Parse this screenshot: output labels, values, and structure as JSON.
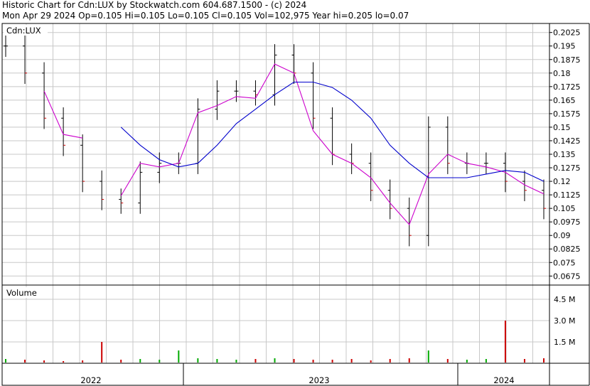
{
  "header": {
    "line1": "Historic Chart for Cdn:LUX by Stockwatch.com 604.687.1500 - (c) 2024",
    "line2": "Mon Apr 29 2024  Op=0.105  Hi=0.105  Lo=0.105  Cl=0.105  Vol=102,975  Year hi=0.205  lo=0.07"
  },
  "colors": {
    "price_bars": "#000000",
    "down_tick": "#cc0000",
    "ma_short": "#cc00cc",
    "ma_long": "#0000cc",
    "vol_up": "#00aa00",
    "vol_down": "#cc0000",
    "grid": "#c8c8c8"
  },
  "chart_data": [
    {
      "type": "line",
      "panel": "price",
      "title": "Cdn:LUX",
      "ylim": [
        0.0625,
        0.2075
      ],
      "y_ticks": [
        "0.2025",
        "0.195",
        "0.1875",
        "0.18",
        "0.1725",
        "0.165",
        "0.1575",
        "0.15",
        "0.1425",
        "0.135",
        "0.1275",
        "0.12",
        "0.1125",
        "0.105",
        "0.0975",
        "0.09",
        "0.0825",
        "0.075",
        "0.0675"
      ],
      "x_labels": [
        "2022",
        "2023",
        "2024"
      ],
      "grid": true,
      "series": [
        {
          "style": "ohlc",
          "x": [
            "2021-12",
            "2022-01",
            "2022-02",
            "2022-03",
            "2022-04",
            "2022-05",
            "2022-06",
            "2022-07",
            "2022-08",
            "2022-09",
            "2022-10",
            "2022-11",
            "2022-12",
            "2023-01",
            "2023-02",
            "2023-03",
            "2023-04",
            "2023-05",
            "2023-06",
            "2023-07",
            "2023-08",
            "2023-09",
            "2023-10",
            "2023-11",
            "2023-12",
            "2024-01",
            "2024-02",
            "2024-03",
            "2024-04"
          ],
          "values": [
            0.195,
            0.18,
            0.155,
            0.14,
            0.12,
            0.11,
            0.108,
            0.125,
            0.13,
            0.13,
            0.16,
            0.17,
            0.17,
            0.168,
            0.19,
            0.18,
            0.155,
            0.135,
            0.13,
            0.115,
            0.105,
            0.09,
            0.15,
            0.13,
            0.13,
            0.13,
            0.12,
            0.115,
            0.105
          ]
        },
        {
          "style": "moving-average",
          "x": [
            "2021-12",
            "2022-01",
            "2022-02",
            "2022-03",
            "2022-04",
            "2022-05",
            "2022-06",
            "2022-07",
            "2022-08",
            "2022-09",
            "2022-10",
            "2022-11",
            "2022-12",
            "2023-01",
            "2023-02",
            "2023-03",
            "2023-04",
            "2023-05",
            "2023-06",
            "2023-07",
            "2023-08",
            "2023-09",
            "2023-10",
            "2023-11",
            "2023-12",
            "2024-01",
            "2024-02",
            "2024-03",
            "2024-04"
          ],
          "values": [
            null,
            null,
            0.17,
            0.146,
            0.144,
            null,
            0.112,
            0.13,
            0.128,
            0.13,
            0.158,
            0.162,
            0.167,
            0.166,
            0.185,
            0.18,
            0.148,
            0.135,
            0.13,
            0.122,
            0.108,
            0.096,
            0.124,
            0.135,
            0.13,
            0.128,
            0.125,
            0.118,
            0.113
          ]
        },
        {
          "style": "moving-average",
          "x": [
            "2021-12",
            "2022-01",
            "2022-02",
            "2022-03",
            "2022-04",
            "2022-05",
            "2022-06",
            "2022-07",
            "2022-08",
            "2022-09",
            "2022-10",
            "2022-11",
            "2022-12",
            "2023-01",
            "2023-02",
            "2023-03",
            "2023-04",
            "2023-05",
            "2023-06",
            "2023-07",
            "2023-08",
            "2023-09",
            "2023-10",
            "2023-11",
            "2023-12",
            "2024-01",
            "2024-02",
            "2024-03",
            "2024-04"
          ],
          "values": [
            null,
            null,
            null,
            null,
            null,
            null,
            0.15,
            0.14,
            0.132,
            0.128,
            0.13,
            0.14,
            0.152,
            0.16,
            0.168,
            0.175,
            0.175,
            0.172,
            0.165,
            0.155,
            0.14,
            0.13,
            0.122,
            0.122,
            0.122,
            0.124,
            0.126,
            0.125,
            0.12
          ]
        }
      ]
    },
    {
      "type": "bar",
      "panel": "volume",
      "title": "Volume",
      "ylim": [
        0,
        5500000
      ],
      "y_ticks": [
        "4.5 M",
        "3.0 M",
        "1.5 M"
      ],
      "x": [
        "2021-12",
        "2022-01",
        "2022-02",
        "2022-03",
        "2022-04",
        "2022-05",
        "2022-06",
        "2022-07",
        "2022-08",
        "2022-09",
        "2022-10",
        "2022-11",
        "2022-12",
        "2023-01",
        "2023-02",
        "2023-03",
        "2023-04",
        "2023-05",
        "2023-06",
        "2023-07",
        "2023-08",
        "2023-09",
        "2023-10",
        "2023-11",
        "2023-12",
        "2024-01",
        "2024-02",
        "2024-03",
        "2024-04"
      ],
      "values": [
        300000,
        250000,
        200000,
        150000,
        200000,
        1500000,
        250000,
        300000,
        250000,
        900000,
        350000,
        300000,
        250000,
        300000,
        350000,
        300000,
        250000,
        250000,
        300000,
        200000,
        300000,
        350000,
        900000,
        300000,
        250000,
        300000,
        3000000,
        300000,
        350000
      ]
    }
  ]
}
